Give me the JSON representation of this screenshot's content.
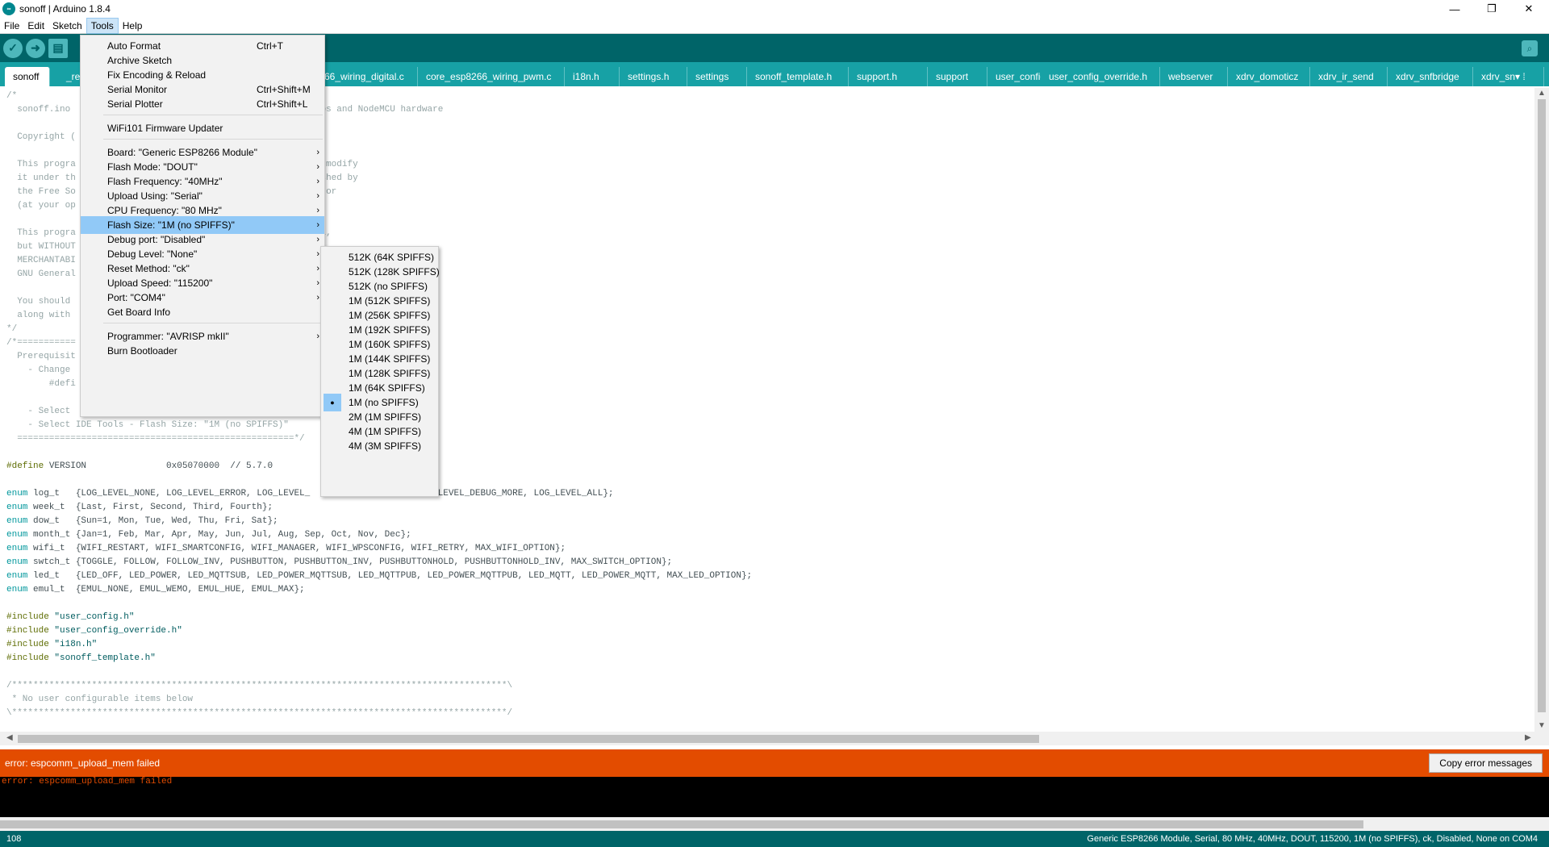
{
  "window": {
    "title": "sonoff | Arduino 1.8.4",
    "app_icon": "∞"
  },
  "window_controls": {
    "minimize": "—",
    "maximize": "❐",
    "close": "✕"
  },
  "menubar": [
    "File",
    "Edit",
    "Sketch",
    "Tools",
    "Help"
  ],
  "toolbar": {
    "verify": "✓",
    "upload": "➜",
    "new": "▤",
    "serial_monitor": "⌕"
  },
  "tabs": [
    "sonoff",
    "_re",
    "66_wiring_digital.c",
    "core_esp8266_wiring_pwm.c",
    "i18n.h",
    "settings.h",
    "settings",
    "sonoff_template.h",
    "support.h",
    "support",
    "user_config.h §",
    "user_config_override.h",
    "webserver",
    "xdrv_domoticz",
    "xdrv_ir_send",
    "xdrv_snfbridge",
    "xdrv_sn▾ ⁞"
  ],
  "code": [
    {
      "parts": [
        {
          "t": "/*",
          "c": "cm"
        }
      ]
    },
    {
      "parts": [
        {
          "t": "  sonoff.ino",
          "c": "cm"
        },
        {
          "t": "                                            Wemos and NodeMCU hardware",
          "c": "cm"
        }
      ]
    },
    {
      "parts": [
        {
          "t": "",
          "c": ""
        }
      ]
    },
    {
      "parts": [
        {
          "t": "  Copyright (",
          "c": "cm"
        }
      ]
    },
    {
      "parts": [
        {
          "t": "",
          "c": ""
        }
      ]
    },
    {
      "parts": [
        {
          "t": "  This progra",
          "c": "cm"
        },
        {
          "t": "                                        and/or modify",
          "c": "cm"
        }
      ]
    },
    {
      "parts": [
        {
          "t": "  it under th",
          "c": "cm"
        },
        {
          "t": "                                       e published by",
          "c": "cm"
        }
      ]
    },
    {
      "parts": [
        {
          "t": "  the Free So",
          "c": "cm"
        },
        {
          "t": "                                       icense, or",
          "c": "cm"
        }
      ]
    },
    {
      "parts": [
        {
          "t": "  (at your op",
          "c": "cm"
        }
      ]
    },
    {
      "parts": [
        {
          "t": "",
          "c": ""
        }
      ]
    },
    {
      "parts": [
        {
          "t": "  This progra",
          "c": "cm"
        },
        {
          "t": "                                       e useful,",
          "c": "cm"
        }
      ]
    },
    {
      "parts": [
        {
          "t": "  but WITHOUT",
          "c": "cm"
        }
      ]
    },
    {
      "parts": [
        {
          "t": "  MERCHANTABI",
          "c": "cm"
        }
      ]
    },
    {
      "parts": [
        {
          "t": "  GNU General",
          "c": "cm"
        }
      ]
    },
    {
      "parts": [
        {
          "t": "",
          "c": ""
        }
      ]
    },
    {
      "parts": [
        {
          "t": "  You should ",
          "c": "cm"
        }
      ]
    },
    {
      "parts": [
        {
          "t": "  along with ",
          "c": "cm"
        }
      ]
    },
    {
      "parts": [
        {
          "t": "*/",
          "c": "cm"
        }
      ]
    },
    {
      "parts": [
        {
          "t": "/*===========",
          "c": "cm"
        }
      ]
    },
    {
      "parts": [
        {
          "t": "  Prerequisit",
          "c": "cm"
        }
      ]
    },
    {
      "parts": [
        {
          "t": "    - Change ",
          "c": "cm"
        }
      ]
    },
    {
      "parts": [
        {
          "t": "        #defi",
          "c": "cm"
        }
      ]
    },
    {
      "parts": [
        {
          "t": "",
          "c": ""
        }
      ]
    },
    {
      "parts": [
        {
          "t": "    - Select ",
          "c": "cm"
        }
      ]
    },
    {
      "parts": [
        {
          "t": "    - Select IDE Tools - Flash Size: \"1M (no SPIFFS)\"",
          "c": "cm"
        }
      ]
    },
    {
      "parts": [
        {
          "t": "  ====================================================*/",
          "c": "cm"
        }
      ]
    },
    {
      "parts": [
        {
          "t": "",
          "c": ""
        }
      ]
    },
    {
      "parts": [
        {
          "t": "#define",
          "c": "pp"
        },
        {
          "t": " VERSION               0x05070000  // 5.7.0",
          "c": ""
        }
      ]
    },
    {
      "parts": [
        {
          "t": "",
          "c": ""
        }
      ]
    },
    {
      "parts": [
        {
          "t": "enum",
          "c": "kw"
        },
        {
          "t": " log_t   {LOG_LEVEL_NONE, LOG_LEVEL_ERROR, LOG_LEVEL_                 G, LOG_LEVEL_DEBUG_MORE, LOG_LEVEL_ALL};",
          "c": ""
        }
      ]
    },
    {
      "parts": [
        {
          "t": "enum",
          "c": "kw"
        },
        {
          "t": " week_t  {Last, First, Second, Third, Fourth};",
          "c": ""
        }
      ]
    },
    {
      "parts": [
        {
          "t": "enum",
          "c": "kw"
        },
        {
          "t": " dow_t   {Sun=1, Mon, Tue, Wed, Thu, Fri, Sat};",
          "c": ""
        }
      ]
    },
    {
      "parts": [
        {
          "t": "enum",
          "c": "kw"
        },
        {
          "t": " month_t {Jan=1, Feb, Mar, Apr, May, Jun, Jul, Aug, Sep, Oct, Nov, Dec};",
          "c": ""
        }
      ]
    },
    {
      "parts": [
        {
          "t": "enum",
          "c": "kw"
        },
        {
          "t": " wifi_t  {WIFI_RESTART, WIFI_SMARTCONFIG, WIFI_MANAGER, WIFI_WPSCONFIG, WIFI_RETRY, MAX_WIFI_OPTION};",
          "c": ""
        }
      ]
    },
    {
      "parts": [
        {
          "t": "enum",
          "c": "kw"
        },
        {
          "t": " swtch_t {TOGGLE, FOLLOW, FOLLOW_INV, PUSHBUTTON, PUSHBUTTON_INV, PUSHBUTTONHOLD, PUSHBUTTONHOLD_INV, MAX_SWITCH_OPTION};",
          "c": ""
        }
      ]
    },
    {
      "parts": [
        {
          "t": "enum",
          "c": "kw"
        },
        {
          "t": " led_t   {LED_OFF, LED_POWER, LED_MQTTSUB, LED_POWER_MQTTSUB, LED_MQTTPUB, LED_POWER_MQTTPUB, LED_MQTT, LED_POWER_MQTT, MAX_LED_OPTION};",
          "c": ""
        }
      ]
    },
    {
      "parts": [
        {
          "t": "enum",
          "c": "kw"
        },
        {
          "t": " emul_t  {EMUL_NONE, EMUL_WEMO, EMUL_HUE, EMUL_MAX};",
          "c": ""
        }
      ]
    },
    {
      "parts": [
        {
          "t": "",
          "c": ""
        }
      ]
    },
    {
      "parts": [
        {
          "t": "#include",
          "c": "pp"
        },
        {
          "t": " \"user_config.h\"",
          "c": "str"
        }
      ]
    },
    {
      "parts": [
        {
          "t": "#include",
          "c": "pp"
        },
        {
          "t": " \"user_config_override.h\"",
          "c": "str"
        }
      ]
    },
    {
      "parts": [
        {
          "t": "#include",
          "c": "pp"
        },
        {
          "t": " \"i18n.h\"",
          "c": "str"
        }
      ]
    },
    {
      "parts": [
        {
          "t": "#include",
          "c": "pp"
        },
        {
          "t": " \"sonoff_template.h\"",
          "c": "str"
        }
      ]
    },
    {
      "parts": [
        {
          "t": "",
          "c": ""
        }
      ]
    },
    {
      "parts": [
        {
          "t": "/*********************************************************************************************\\",
          "c": "cm"
        }
      ]
    },
    {
      "parts": [
        {
          "t": " * No user configurable items below",
          "c": "cm"
        }
      ]
    },
    {
      "parts": [
        {
          "t": "\\*********************************************************************************************/",
          "c": "cm"
        }
      ]
    }
  ],
  "tools_menu": {
    "items": [
      {
        "label": "Auto Format",
        "shortcut": "Ctrl+T"
      },
      {
        "label": "Archive Sketch"
      },
      {
        "label": "Fix Encoding & Reload"
      },
      {
        "label": "Serial Monitor",
        "shortcut": "Ctrl+Shift+M"
      },
      {
        "label": "Serial Plotter",
        "shortcut": "Ctrl+Shift+L"
      },
      {
        "sep": true
      },
      {
        "label": "WiFi101 Firmware Updater"
      },
      {
        "sep": true
      },
      {
        "label": "Board: \"Generic ESP8266 Module\"",
        "sub": true
      },
      {
        "label": "Flash Mode: \"DOUT\"",
        "sub": true
      },
      {
        "label": "Flash Frequency: \"40MHz\"",
        "sub": true
      },
      {
        "label": "Upload Using: \"Serial\"",
        "sub": true
      },
      {
        "label": "CPU Frequency: \"80 MHz\"",
        "sub": true
      },
      {
        "label": "Flash Size: \"1M (no SPIFFS)\"",
        "sub": true,
        "highlight": true
      },
      {
        "label": "Debug port: \"Disabled\"",
        "sub": true
      },
      {
        "label": "Debug Level: \"None\"",
        "sub": true
      },
      {
        "label": "Reset Method: \"ck\"",
        "sub": true
      },
      {
        "label": "Upload Speed: \"115200\"",
        "sub": true
      },
      {
        "label": "Port: \"COM4\"",
        "sub": true
      },
      {
        "label": "Get Board Info"
      },
      {
        "sep": true
      },
      {
        "label": "Programmer: \"AVRISP mkII\"",
        "sub": true
      },
      {
        "label": "Burn Bootloader"
      }
    ],
    "submenu_arrow": "›"
  },
  "flash_size_submenu": {
    "items": [
      "512K (64K SPIFFS)",
      "512K (128K SPIFFS)",
      "512K (no SPIFFS)",
      "1M (512K SPIFFS)",
      "1M (256K SPIFFS)",
      "1M (192K SPIFFS)",
      "1M (160K SPIFFS)",
      "1M (144K SPIFFS)",
      "1M (128K SPIFFS)",
      "1M (64K SPIFFS)",
      "1M (no SPIFFS)",
      "2M (1M SPIFFS)",
      "4M (1M SPIFFS)",
      "4M (3M SPIFFS)"
    ],
    "selected_index": 10,
    "check_mark": "●"
  },
  "console": {
    "error_bar": "error: espcomm_upload_mem failed",
    "copy_button": "Copy error messages",
    "output": "error: espcomm_upload_mem failed"
  },
  "status": {
    "line": "108",
    "board": "Generic ESP8266 Module, Serial, 80 MHz, 40MHz, DOUT, 115200, 1M (no SPIFFS), ck, Disabled, None on COM4"
  },
  "scroll_arrows": {
    "up": "▲",
    "down": "▼",
    "left": "◀",
    "right": "▶"
  }
}
